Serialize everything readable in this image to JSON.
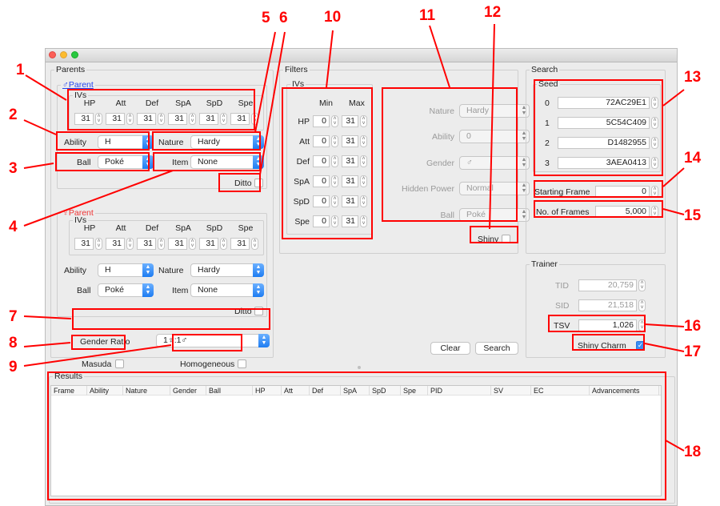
{
  "window": {
    "controls": [
      "close",
      "minimize",
      "maximize"
    ]
  },
  "parents": {
    "title": "Parents",
    "male": {
      "title": "♂Parent",
      "color": "#2244ee",
      "ivs_title": "IVs",
      "iv_labels": [
        "HP",
        "Att",
        "Def",
        "SpA",
        "SpD",
        "Spe"
      ],
      "iv_values": [
        "31",
        "31",
        "31",
        "31",
        "31",
        "31"
      ],
      "ability_label": "Ability",
      "ability_value": "H",
      "nature_label": "Nature",
      "nature_value": "Hardy",
      "ball_label": "Ball",
      "ball_value": "Poké",
      "item_label": "Item",
      "item_value": "None",
      "ditto_label": "Ditto",
      "ditto_checked": false
    },
    "female": {
      "title": "♀Parent",
      "color": "#ee3333",
      "ivs_title": "IVs",
      "iv_labels": [
        "HP",
        "Att",
        "Def",
        "SpA",
        "SpD",
        "Spe"
      ],
      "iv_values": [
        "31",
        "31",
        "31",
        "31",
        "31",
        "31"
      ],
      "ability_label": "Ability",
      "ability_value": "H",
      "nature_label": "Nature",
      "nature_value": "Hardy",
      "ball_label": "Ball",
      "ball_value": "Poké",
      "item_label": "Item",
      "item_value": "None",
      "ditto_label": "Ditto",
      "ditto_checked": false
    },
    "gender_ratio_label": "Gender Ratio",
    "gender_ratio_value": "1♀:1♂",
    "masuda_label": "Masuda",
    "masuda_checked": false,
    "homogeneous_label": "Homogeneous",
    "homogeneous_checked": false
  },
  "filters": {
    "title": "Filters",
    "ivs_title": "IVs",
    "min_label": "Min",
    "max_label": "Max",
    "rows": [
      {
        "stat": "HP",
        "min": "0",
        "max": "31"
      },
      {
        "stat": "Att",
        "min": "0",
        "max": "31"
      },
      {
        "stat": "Def",
        "min": "0",
        "max": "31"
      },
      {
        "stat": "SpA",
        "min": "0",
        "max": "31"
      },
      {
        "stat": "SpD",
        "min": "0",
        "max": "31"
      },
      {
        "stat": "Spe",
        "min": "0",
        "max": "31"
      }
    ],
    "nature_label": "Nature",
    "nature_value": "Hardy",
    "ability_label": "Ability",
    "ability_value": "0",
    "gender_label": "Gender",
    "gender_value": "♂",
    "hidden_power_label": "Hidden Power",
    "hidden_power_value": "Normal",
    "ball_label": "Ball",
    "ball_value": "Poké",
    "shiny_label": "Shiny",
    "shiny_checked": false,
    "clear_label": "Clear",
    "search_label": "Search"
  },
  "search": {
    "title": "Search",
    "seed_title": "Seed",
    "seeds": [
      {
        "index": "0",
        "value": "72AC29E1"
      },
      {
        "index": "1",
        "value": "5C54C409"
      },
      {
        "index": "2",
        "value": "D1482955"
      },
      {
        "index": "3",
        "value": "3AEA0413"
      }
    ],
    "starting_frame_label": "Starting Frame",
    "starting_frame_value": "0",
    "num_frames_label": "No. of Frames",
    "num_frames_value": "5,000"
  },
  "trainer": {
    "title": "Trainer",
    "tid_label": "TID",
    "tid_value": "20,759",
    "sid_label": "SID",
    "sid_value": "21,518",
    "tsv_label": "TSV",
    "tsv_value": "1,026",
    "shiny_charm_label": "Shiny Charm",
    "shiny_charm_checked": true
  },
  "results": {
    "title": "Results",
    "columns": [
      "Frame",
      "Ability",
      "Nature",
      "Gender",
      "Ball",
      "HP",
      "Att",
      "Def",
      "SpA",
      "SpD",
      "Spe",
      "PID",
      "SV",
      "EC",
      "Advancements"
    ],
    "rows": []
  },
  "annotations": {
    "color": "#ff0000",
    "labels": [
      "1",
      "2",
      "3",
      "4",
      "5",
      "6",
      "7",
      "8",
      "9",
      "10",
      "11",
      "12",
      "13",
      "14",
      "15",
      "16",
      "17",
      "18"
    ]
  }
}
